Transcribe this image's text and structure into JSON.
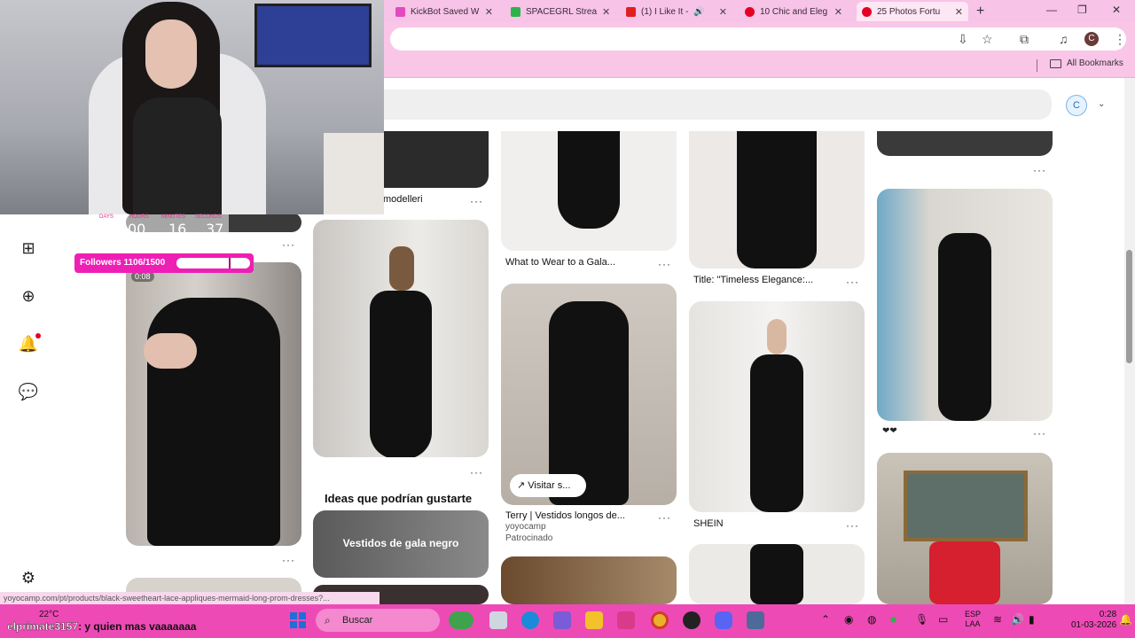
{
  "browser": {
    "tabs": [
      {
        "label": "KickBot Saved W",
        "color": "#e24ac0"
      },
      {
        "label": "SPACEGRL Strea",
        "color": "#2db34a"
      },
      {
        "label": "(1) I Like It -",
        "color": "#e02020"
      },
      {
        "label": "10 Chic and Eleg",
        "color": "#e60023"
      },
      {
        "label": "25 Photos Fortu",
        "color": "#e60023"
      }
    ],
    "new_tab": "+",
    "profile_initial": "C",
    "bookmarks_label": "All Bookmarks",
    "status_url": "yoyocamp.com/pt/products/black-sweetheart-lace-appliques-mermaid-long-prom-dresses?..."
  },
  "pinterest": {
    "account_initial": "C",
    "pins": [
      {
        "caption": "modelleri"
      },
      {
        "caption": "What to Wear to a Gala..."
      },
      {
        "caption": "Title: \"Timeless Elegance:..."
      },
      {
        "caption": "Terry | Vestidos longos de...",
        "source": "yoyocamp",
        "sponsored": "Patrocinado",
        "visit_label": "Visitar s..."
      },
      {
        "caption": "SHEIN"
      },
      {
        "caption": "0:08"
      }
    ],
    "ideas_heading": "Ideas que podrían gustarte",
    "ideas_card": "Vestidos de gala negro",
    "reaction_hearts": "❤❤"
  },
  "stream": {
    "countdown": {
      "labels": [
        "DAYS",
        "HOURS",
        "MINUTES",
        "SECONDS"
      ],
      "values": [
        "0",
        "00",
        "16",
        "37"
      ]
    },
    "followers_text": "Followers 1106/1500",
    "followers_progress": 0.737,
    "chat": {
      "user": "elprimate3157",
      "message": ": y quien mas vaaaaaaa"
    }
  },
  "taskbar": {
    "weather": "22°C",
    "search_label": "Buscar",
    "lang_line1": "ESP",
    "lang_line2": "LAA",
    "time": "0:28",
    "date": "01-03-2026"
  },
  "colors": {
    "pinterest_red": "#e60023",
    "stream_pink": "#ee1fb5",
    "taskbar": "#ee4ab6"
  }
}
